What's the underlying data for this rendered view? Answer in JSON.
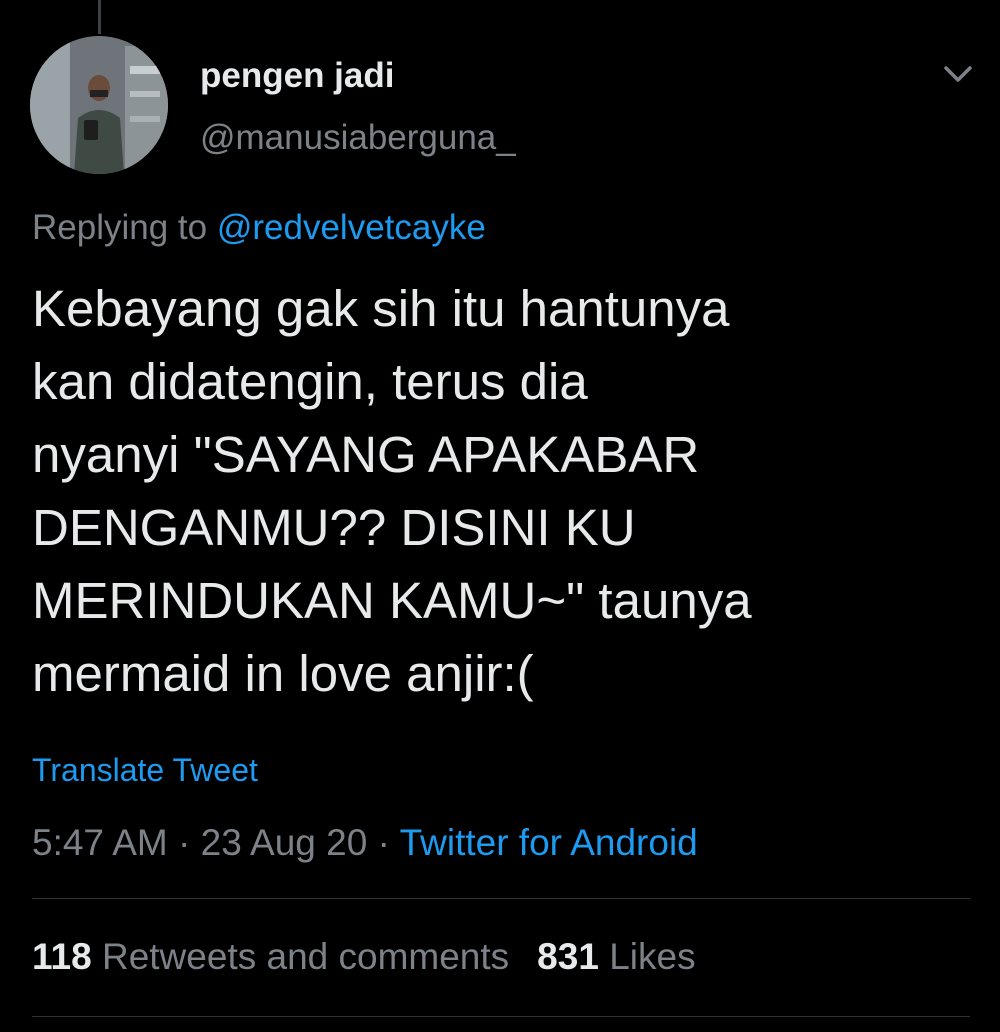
{
  "tweet": {
    "display_name": "pengen jadi",
    "handle": "@manusiaberguna_",
    "replying_prefix": "Replying to",
    "replying_to": "@redvelvetcayke",
    "text_lines": [
      "Kebayang gak sih itu hantunya",
      "kan didatengin, terus dia",
      "nyanyi \"SAYANG APAKABAR",
      "DENGANMU?? DISINI KU",
      "MERINDUKAN KAMU~\" taunya",
      "mermaid in love anjir:("
    ],
    "translate_label": "Translate Tweet",
    "time": "5:47 AM",
    "separator": "·",
    "date": "23 Aug 20",
    "source": "Twitter for Android",
    "retweets_count": "118",
    "retweets_label": "Retweets and comments",
    "likes_count": "831",
    "likes_label": "Likes"
  },
  "icons": {
    "avatar": "profile-photo-avatar",
    "caret": "chevron-down-icon"
  },
  "colors": {
    "background": "#000000",
    "primary_text": "#e7e9ea",
    "secondary_text": "#7c8288",
    "link": "#1d9bf0",
    "divider": "#2f3336"
  }
}
